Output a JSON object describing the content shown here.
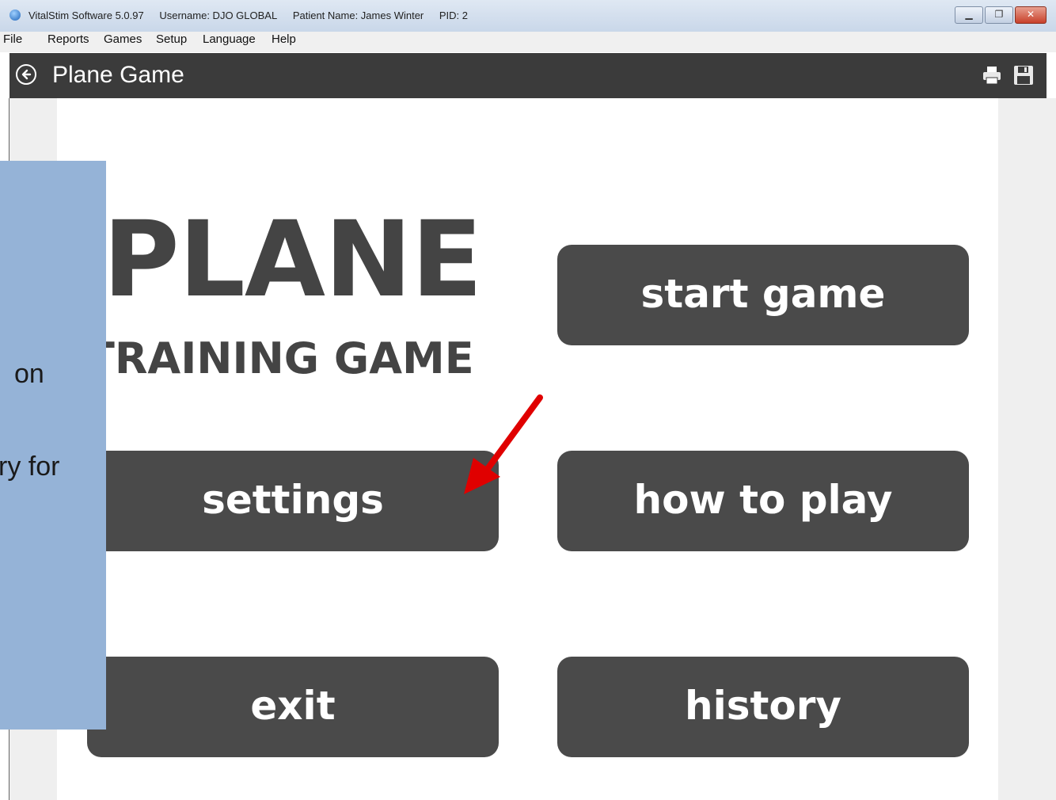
{
  "window": {
    "app_title": "VitalStim Software 5.0.97",
    "username": "Username: DJO GLOBAL",
    "patient": "Patient Name: James Winter",
    "pid": "PID: 2",
    "controls": {
      "minimize_icon": "minimize-icon",
      "restore_icon": "restore-icon",
      "close_icon": "close-icon"
    }
  },
  "menu": {
    "items": [
      "File",
      "Reports",
      "Games",
      "Setup",
      "Language",
      "Help"
    ]
  },
  "header": {
    "title": "Plane Game",
    "back_icon": "back-arrow-circle-icon",
    "print_icon": "printer-icon",
    "save_icon": "floppy-disk-icon"
  },
  "game": {
    "title": "PLANE",
    "subtitle": "TRAINING GAME",
    "buttons": {
      "start": "start game",
      "settings": "settings",
      "how_to_play": "how to play",
      "exit": "exit",
      "history": "history"
    }
  },
  "overlay": {
    "color": "#95b3d7",
    "lines": [
      "on",
      "ry for"
    ]
  },
  "annotation": {
    "arrow_color": "#e00000",
    "arrow_icon": "red-arrow-icon"
  }
}
